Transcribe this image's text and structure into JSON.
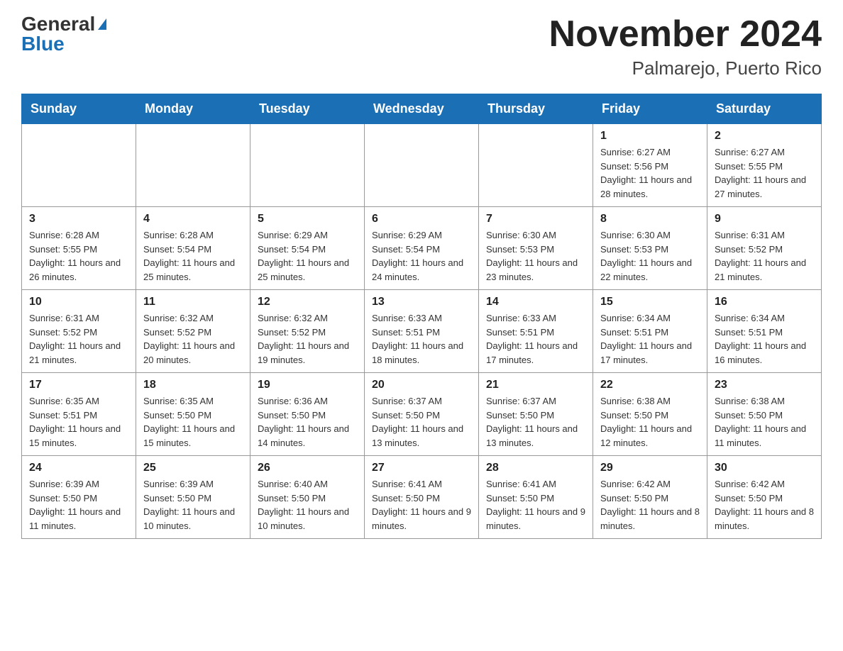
{
  "header": {
    "logo_general": "General",
    "logo_blue": "Blue",
    "month_title": "November 2024",
    "location": "Palmarejo, Puerto Rico"
  },
  "calendar": {
    "days_of_week": [
      "Sunday",
      "Monday",
      "Tuesday",
      "Wednesday",
      "Thursday",
      "Friday",
      "Saturday"
    ],
    "weeks": [
      [
        {
          "day": "",
          "info": ""
        },
        {
          "day": "",
          "info": ""
        },
        {
          "day": "",
          "info": ""
        },
        {
          "day": "",
          "info": ""
        },
        {
          "day": "",
          "info": ""
        },
        {
          "day": "1",
          "info": "Sunrise: 6:27 AM\nSunset: 5:56 PM\nDaylight: 11 hours and 28 minutes."
        },
        {
          "day": "2",
          "info": "Sunrise: 6:27 AM\nSunset: 5:55 PM\nDaylight: 11 hours and 27 minutes."
        }
      ],
      [
        {
          "day": "3",
          "info": "Sunrise: 6:28 AM\nSunset: 5:55 PM\nDaylight: 11 hours and 26 minutes."
        },
        {
          "day": "4",
          "info": "Sunrise: 6:28 AM\nSunset: 5:54 PM\nDaylight: 11 hours and 25 minutes."
        },
        {
          "day": "5",
          "info": "Sunrise: 6:29 AM\nSunset: 5:54 PM\nDaylight: 11 hours and 25 minutes."
        },
        {
          "day": "6",
          "info": "Sunrise: 6:29 AM\nSunset: 5:54 PM\nDaylight: 11 hours and 24 minutes."
        },
        {
          "day": "7",
          "info": "Sunrise: 6:30 AM\nSunset: 5:53 PM\nDaylight: 11 hours and 23 minutes."
        },
        {
          "day": "8",
          "info": "Sunrise: 6:30 AM\nSunset: 5:53 PM\nDaylight: 11 hours and 22 minutes."
        },
        {
          "day": "9",
          "info": "Sunrise: 6:31 AM\nSunset: 5:52 PM\nDaylight: 11 hours and 21 minutes."
        }
      ],
      [
        {
          "day": "10",
          "info": "Sunrise: 6:31 AM\nSunset: 5:52 PM\nDaylight: 11 hours and 21 minutes."
        },
        {
          "day": "11",
          "info": "Sunrise: 6:32 AM\nSunset: 5:52 PM\nDaylight: 11 hours and 20 minutes."
        },
        {
          "day": "12",
          "info": "Sunrise: 6:32 AM\nSunset: 5:52 PM\nDaylight: 11 hours and 19 minutes."
        },
        {
          "day": "13",
          "info": "Sunrise: 6:33 AM\nSunset: 5:51 PM\nDaylight: 11 hours and 18 minutes."
        },
        {
          "day": "14",
          "info": "Sunrise: 6:33 AM\nSunset: 5:51 PM\nDaylight: 11 hours and 17 minutes."
        },
        {
          "day": "15",
          "info": "Sunrise: 6:34 AM\nSunset: 5:51 PM\nDaylight: 11 hours and 17 minutes."
        },
        {
          "day": "16",
          "info": "Sunrise: 6:34 AM\nSunset: 5:51 PM\nDaylight: 11 hours and 16 minutes."
        }
      ],
      [
        {
          "day": "17",
          "info": "Sunrise: 6:35 AM\nSunset: 5:51 PM\nDaylight: 11 hours and 15 minutes."
        },
        {
          "day": "18",
          "info": "Sunrise: 6:35 AM\nSunset: 5:50 PM\nDaylight: 11 hours and 15 minutes."
        },
        {
          "day": "19",
          "info": "Sunrise: 6:36 AM\nSunset: 5:50 PM\nDaylight: 11 hours and 14 minutes."
        },
        {
          "day": "20",
          "info": "Sunrise: 6:37 AM\nSunset: 5:50 PM\nDaylight: 11 hours and 13 minutes."
        },
        {
          "day": "21",
          "info": "Sunrise: 6:37 AM\nSunset: 5:50 PM\nDaylight: 11 hours and 13 minutes."
        },
        {
          "day": "22",
          "info": "Sunrise: 6:38 AM\nSunset: 5:50 PM\nDaylight: 11 hours and 12 minutes."
        },
        {
          "day": "23",
          "info": "Sunrise: 6:38 AM\nSunset: 5:50 PM\nDaylight: 11 hours and 11 minutes."
        }
      ],
      [
        {
          "day": "24",
          "info": "Sunrise: 6:39 AM\nSunset: 5:50 PM\nDaylight: 11 hours and 11 minutes."
        },
        {
          "day": "25",
          "info": "Sunrise: 6:39 AM\nSunset: 5:50 PM\nDaylight: 11 hours and 10 minutes."
        },
        {
          "day": "26",
          "info": "Sunrise: 6:40 AM\nSunset: 5:50 PM\nDaylight: 11 hours and 10 minutes."
        },
        {
          "day": "27",
          "info": "Sunrise: 6:41 AM\nSunset: 5:50 PM\nDaylight: 11 hours and 9 minutes."
        },
        {
          "day": "28",
          "info": "Sunrise: 6:41 AM\nSunset: 5:50 PM\nDaylight: 11 hours and 9 minutes."
        },
        {
          "day": "29",
          "info": "Sunrise: 6:42 AM\nSunset: 5:50 PM\nDaylight: 11 hours and 8 minutes."
        },
        {
          "day": "30",
          "info": "Sunrise: 6:42 AM\nSunset: 5:50 PM\nDaylight: 11 hours and 8 minutes."
        }
      ]
    ]
  }
}
